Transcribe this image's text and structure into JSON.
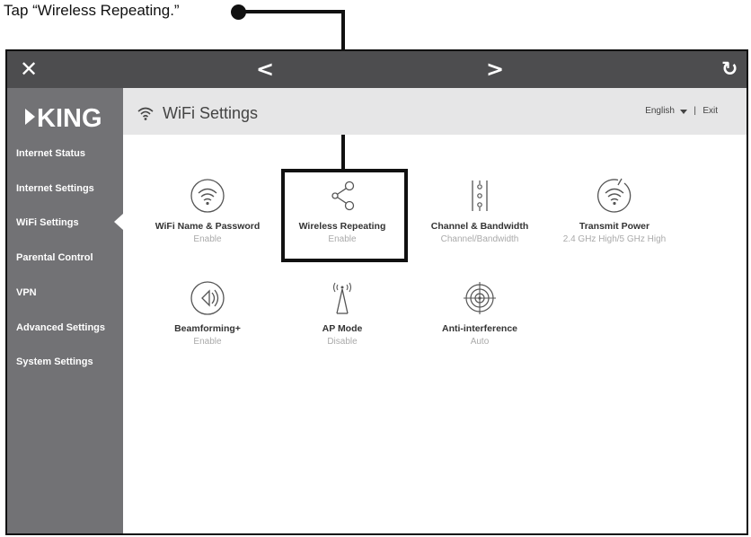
{
  "callout": {
    "text": "Tap “Wireless Repeating.”"
  },
  "topbar": {
    "close": "✕",
    "back": "<",
    "forward": ">",
    "refresh": "↻"
  },
  "sidebar": {
    "logo": "KING",
    "items": [
      {
        "label": "Internet Status"
      },
      {
        "label": "Internet Settings"
      },
      {
        "label": "WiFi Settings"
      },
      {
        "label": "Parental Control"
      },
      {
        "label": "VPN"
      },
      {
        "label": "Advanced Settings"
      },
      {
        "label": "System Settings"
      }
    ],
    "active_index": 2
  },
  "header": {
    "title": "WiFi Settings",
    "language": "English",
    "separator": "|",
    "exit": "Exit"
  },
  "tiles": [
    {
      "label": "WiFi Name & Password",
      "sub": "Enable",
      "icon": "wifi-circle-icon"
    },
    {
      "label": "Wireless Repeating",
      "sub": "Enable",
      "icon": "share-icon"
    },
    {
      "label": "Channel & Bandwidth",
      "sub": "Channel/Bandwidth",
      "icon": "channel-bars-icon"
    },
    {
      "label": "Transmit Power",
      "sub": "2.4 GHz High/5 GHz High",
      "icon": "wifi-power-icon"
    },
    {
      "label": "Beamforming+",
      "sub": "Enable",
      "icon": "beamforming-icon"
    },
    {
      "label": "AP Mode",
      "sub": "Disable",
      "icon": "antenna-icon"
    },
    {
      "label": "Anti-interference",
      "sub": "Auto",
      "icon": "target-icon"
    }
  ]
}
